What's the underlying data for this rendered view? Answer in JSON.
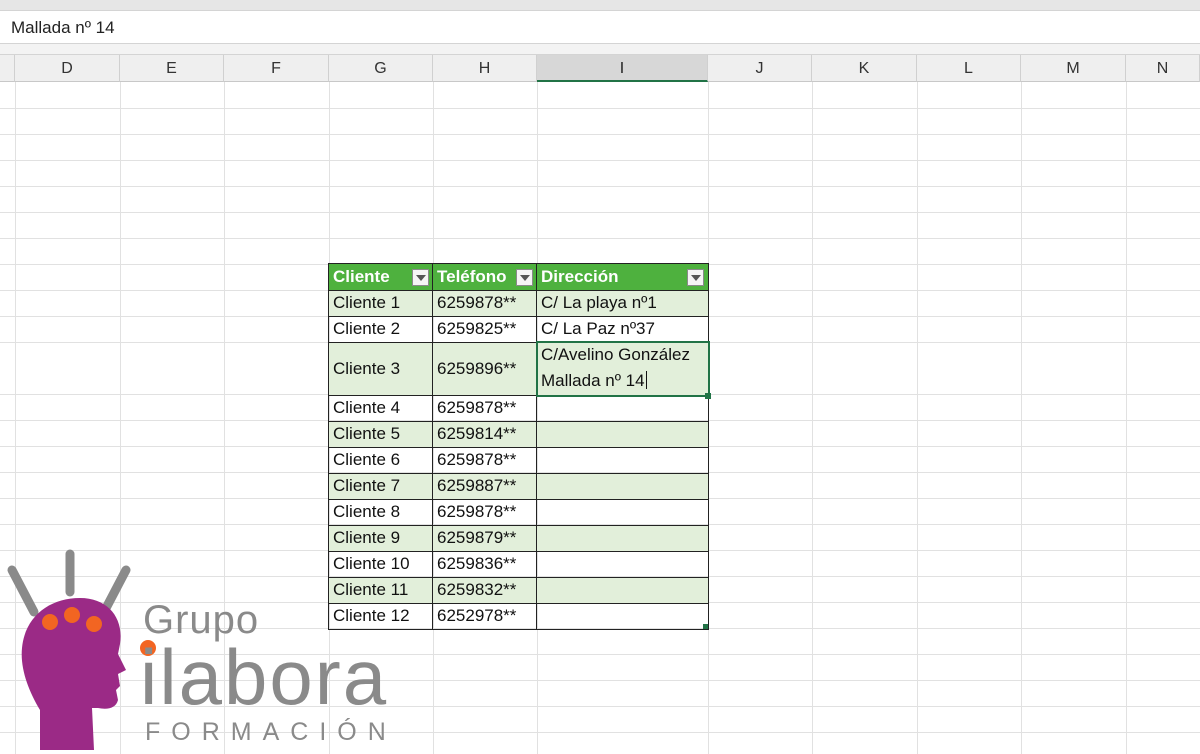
{
  "formula_bar": {
    "content": "Mallada nº 14"
  },
  "columns": [
    "D",
    "E",
    "F",
    "G",
    "H",
    "I",
    "J",
    "K",
    "L",
    "M",
    "N"
  ],
  "selected_column": "I",
  "table": {
    "headers": [
      "Cliente",
      "Teléfono",
      "Dirección"
    ],
    "rows": [
      {
        "cliente": "Cliente 1",
        "telefono": "6259878**",
        "direccion": "C/ La playa nº1"
      },
      {
        "cliente": "Cliente 2",
        "telefono": "6259825**",
        "direccion": "C/ La Paz nº37"
      },
      {
        "cliente": "Cliente 3",
        "telefono": "6259896**",
        "direccion_line1": "C/Avelino González",
        "direccion_line2": "Mallada nº 14"
      },
      {
        "cliente": "Cliente 4",
        "telefono": "6259878**",
        "direccion": ""
      },
      {
        "cliente": "Cliente 5",
        "telefono": "6259814**",
        "direccion": ""
      },
      {
        "cliente": "Cliente 6",
        "telefono": "6259878**",
        "direccion": ""
      },
      {
        "cliente": "Cliente 7",
        "telefono": "6259887**",
        "direccion": ""
      },
      {
        "cliente": "Cliente 8",
        "telefono": "6259878**",
        "direccion": ""
      },
      {
        "cliente": "Cliente 9",
        "telefono": "6259879**",
        "direccion": ""
      },
      {
        "cliente": "Cliente 10",
        "telefono": "6259836**",
        "direccion": ""
      },
      {
        "cliente": "Cliente 11",
        "telefono": "6259832**",
        "direccion": ""
      },
      {
        "cliente": "Cliente 12",
        "telefono": "6252978**",
        "direccion": ""
      }
    ]
  },
  "colors": {
    "header_green": "#4eb13e",
    "band_green": "#e2efda",
    "active_border": "#217346",
    "logo_purple": "#9b2a86",
    "logo_orange": "#f26522"
  },
  "logo": {
    "line1": "Grupo",
    "line2": "ilabora",
    "line3": "FORMACIÓN",
    "icon": "head-icon"
  }
}
